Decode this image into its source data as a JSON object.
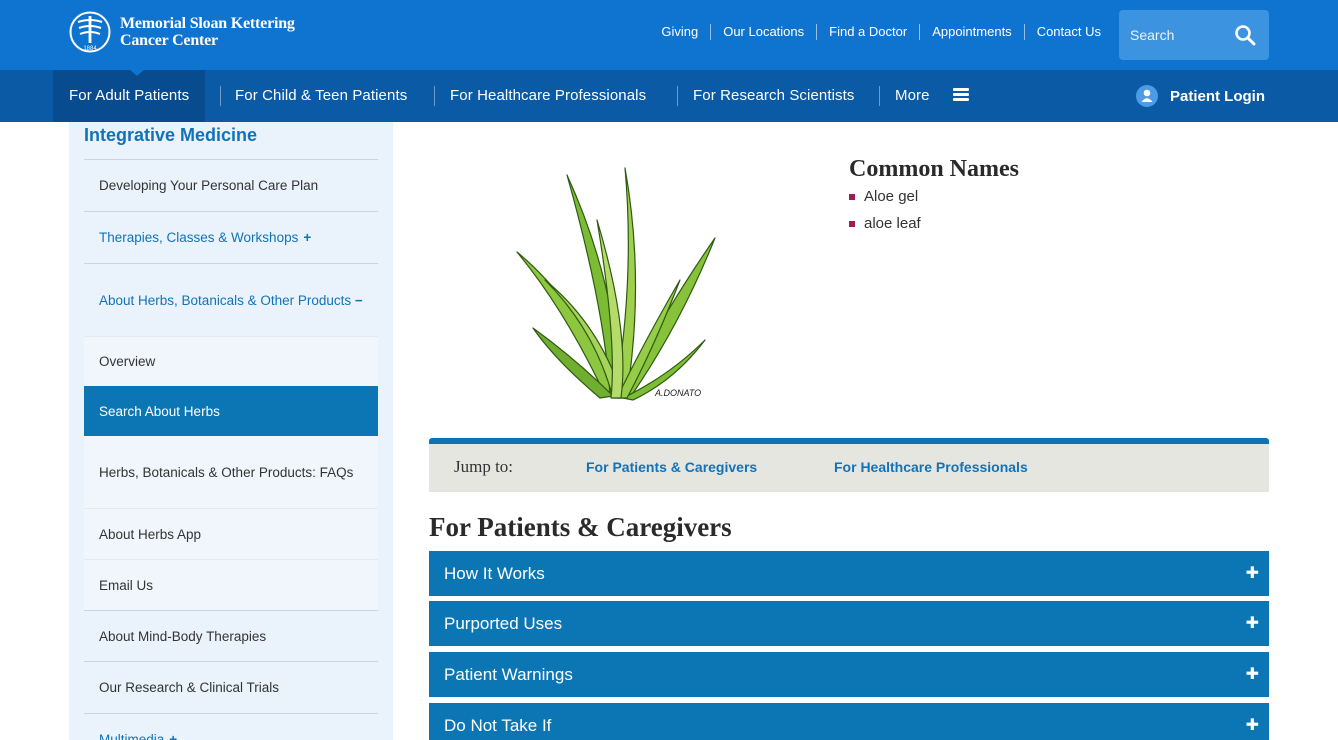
{
  "header": {
    "logo": {
      "line1": "Memorial Sloan Kettering",
      "line2": "Cancer Center",
      "year": "1884"
    },
    "utility_links": [
      "Giving",
      "Our Locations",
      "Find a Doctor",
      "Appointments",
      "Contact Us"
    ],
    "search": {
      "placeholder": "Search"
    }
  },
  "main_nav": {
    "items": [
      "For Adult Patients",
      "For Child & Teen Patients",
      "For Healthcare Professionals",
      "For Research Scientists",
      "More"
    ],
    "active_index": 0,
    "login_label": "Patient Login"
  },
  "sidebar": {
    "title": "Integrative Medicine",
    "items": [
      {
        "label": "Developing Your Personal Care Plan"
      },
      {
        "label": "Therapies, Classes & Workshops",
        "suffix": "+"
      },
      {
        "label": "About Herbs, Botanicals & Other Products",
        "suffix": "−"
      },
      {
        "label": "Overview"
      },
      {
        "label": "Search About Herbs"
      },
      {
        "label": "Herbs, Botanicals & Other Products: FAQs"
      },
      {
        "label": "About Herbs App"
      },
      {
        "label": "Email Us"
      },
      {
        "label": "About Mind-Body Therapies"
      },
      {
        "label": "Our Research & Clinical Trials"
      },
      {
        "label": "Multimedia",
        "suffix": "+"
      }
    ]
  },
  "content": {
    "image_signature": "A.DONATO",
    "common_names_title": "Common Names",
    "common_names": [
      "Aloe gel",
      "aloe leaf"
    ],
    "jump": {
      "label": "Jump to:",
      "links": [
        "For Patients & Caregivers",
        "For Healthcare Professionals"
      ]
    },
    "section_title": "For Patients & Caregivers",
    "accordions": [
      "How It Works",
      "Purported Uses",
      "Patient Warnings",
      "Do Not Take If"
    ]
  },
  "colors": {
    "header_blue": "#0f74cf",
    "nav_blue": "#0b5aa6",
    "accent_blue": "#0c76b5",
    "link_blue": "#1272b8",
    "bullet_magenta": "#a11a5a",
    "sidebar_bg": "#eaf3fb"
  },
  "icons": [
    "logo-mark-icon",
    "search-icon",
    "menu-icon",
    "user-icon",
    "plus-icon",
    "minus-icon"
  ]
}
